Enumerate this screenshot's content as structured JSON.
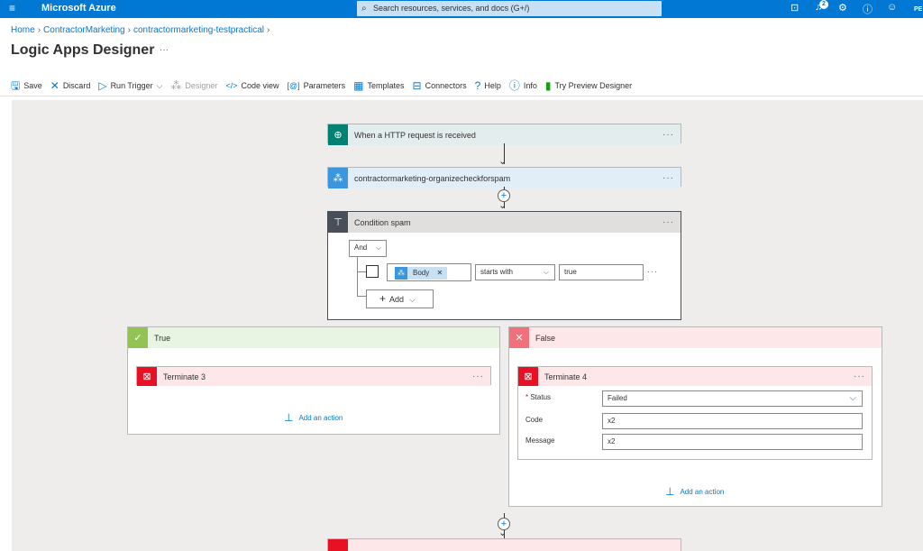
{
  "topbar": {
    "menu_icon": "hamburger-icon",
    "brand": "Microsoft Azure",
    "search_placeholder": "Search resources, services, and docs (G+/)",
    "notification_count": "2",
    "user_initials": "PE"
  },
  "breadcrumbs": [
    "Home",
    "ContractorMarketing",
    "contractormarketing-testpractical"
  ],
  "page_title": "Logic Apps Designer",
  "title_more": "···",
  "toolbar": {
    "save": "Save",
    "discard": "Discard",
    "run_trigger": "Run Trigger",
    "designer": "Designer",
    "code_view": "Code view",
    "parameters": "Parameters",
    "templates": "Templates",
    "connectors": "Connectors",
    "help": "Help",
    "info": "Info",
    "try_preview": "Try Preview Designer"
  },
  "steps": {
    "trigger": "When a HTTP request is received",
    "organize": "contractormarketing-organizecheckforspam",
    "condition": "Condition spam",
    "more": "···"
  },
  "condition": {
    "group_operator": "And",
    "token": "Body",
    "operator": "starts with",
    "value": "true",
    "add_label": "Add"
  },
  "true_branch": {
    "label": "True",
    "action": "Terminate 3",
    "add_action": "Add an action"
  },
  "false_branch": {
    "label": "False",
    "action": "Terminate 4",
    "status_label": "Status",
    "status_value": "Failed",
    "code_label": "Code",
    "code_value": "x2",
    "message_label": "Message",
    "message_value": "x2",
    "add_action": "Add an action"
  },
  "colors": {
    "azure_blue": "#0078d4",
    "trigger_teal": "#008272",
    "condition_dark": "#484f58",
    "terminate_red": "#e81123",
    "true_green": "#6bb700",
    "false_red": "#f1707b"
  }
}
